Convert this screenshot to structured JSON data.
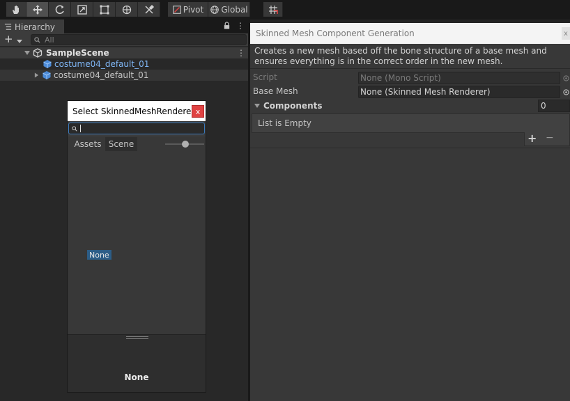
{
  "toolbar": {
    "tools": [
      {
        "name": "hand-tool",
        "icon": "hand-icon"
      },
      {
        "name": "move-tool",
        "icon": "move-icon"
      },
      {
        "name": "rotate-tool",
        "icon": "rotate-icon"
      },
      {
        "name": "scale-tool",
        "icon": "scale-icon"
      },
      {
        "name": "rect-tool",
        "icon": "rect-icon"
      },
      {
        "name": "transform-tool",
        "icon": "transform-icon"
      },
      {
        "name": "custom-tool",
        "icon": "tools-icon"
      }
    ],
    "pivot_label": "Pivot",
    "global_label": "Global"
  },
  "hierarchy": {
    "tab_label": "Hierarchy",
    "search_placeholder": "All",
    "scene_name": "SampleScene",
    "items": [
      {
        "label": "costume04_default_01",
        "color": "#7fb6f5",
        "expandable": false
      },
      {
        "label": "costume04_default_01",
        "color": "#c4c4c4",
        "expandable": true
      }
    ]
  },
  "popup": {
    "title": "Select SkinnedMeshRenderer",
    "close_label": "x",
    "search_value": "",
    "tabs": [
      "Assets",
      "Scene"
    ],
    "active_tab": "Scene",
    "none_item_label": "None",
    "preview_label": "None"
  },
  "inspector": {
    "title": "Skinned Mesh Component Generation",
    "close_label": "x",
    "description": "Creates a new mesh based off the bone structure of a base mesh and ensures everything is in the correct order in the new mesh.",
    "script_label": "Script",
    "script_value": "None (Mono Script)",
    "base_mesh_label": "Base Mesh",
    "base_mesh_value": "None (Skinned Mesh Renderer)",
    "components_label": "Components",
    "components_count": "0",
    "list_empty_label": "List is Empty",
    "add_label": "+",
    "remove_label": "−"
  },
  "colors": {
    "selection_blue": "#2c5d87",
    "accent_red": "#e04343",
    "prefab_blue": "#7fb6f5"
  }
}
